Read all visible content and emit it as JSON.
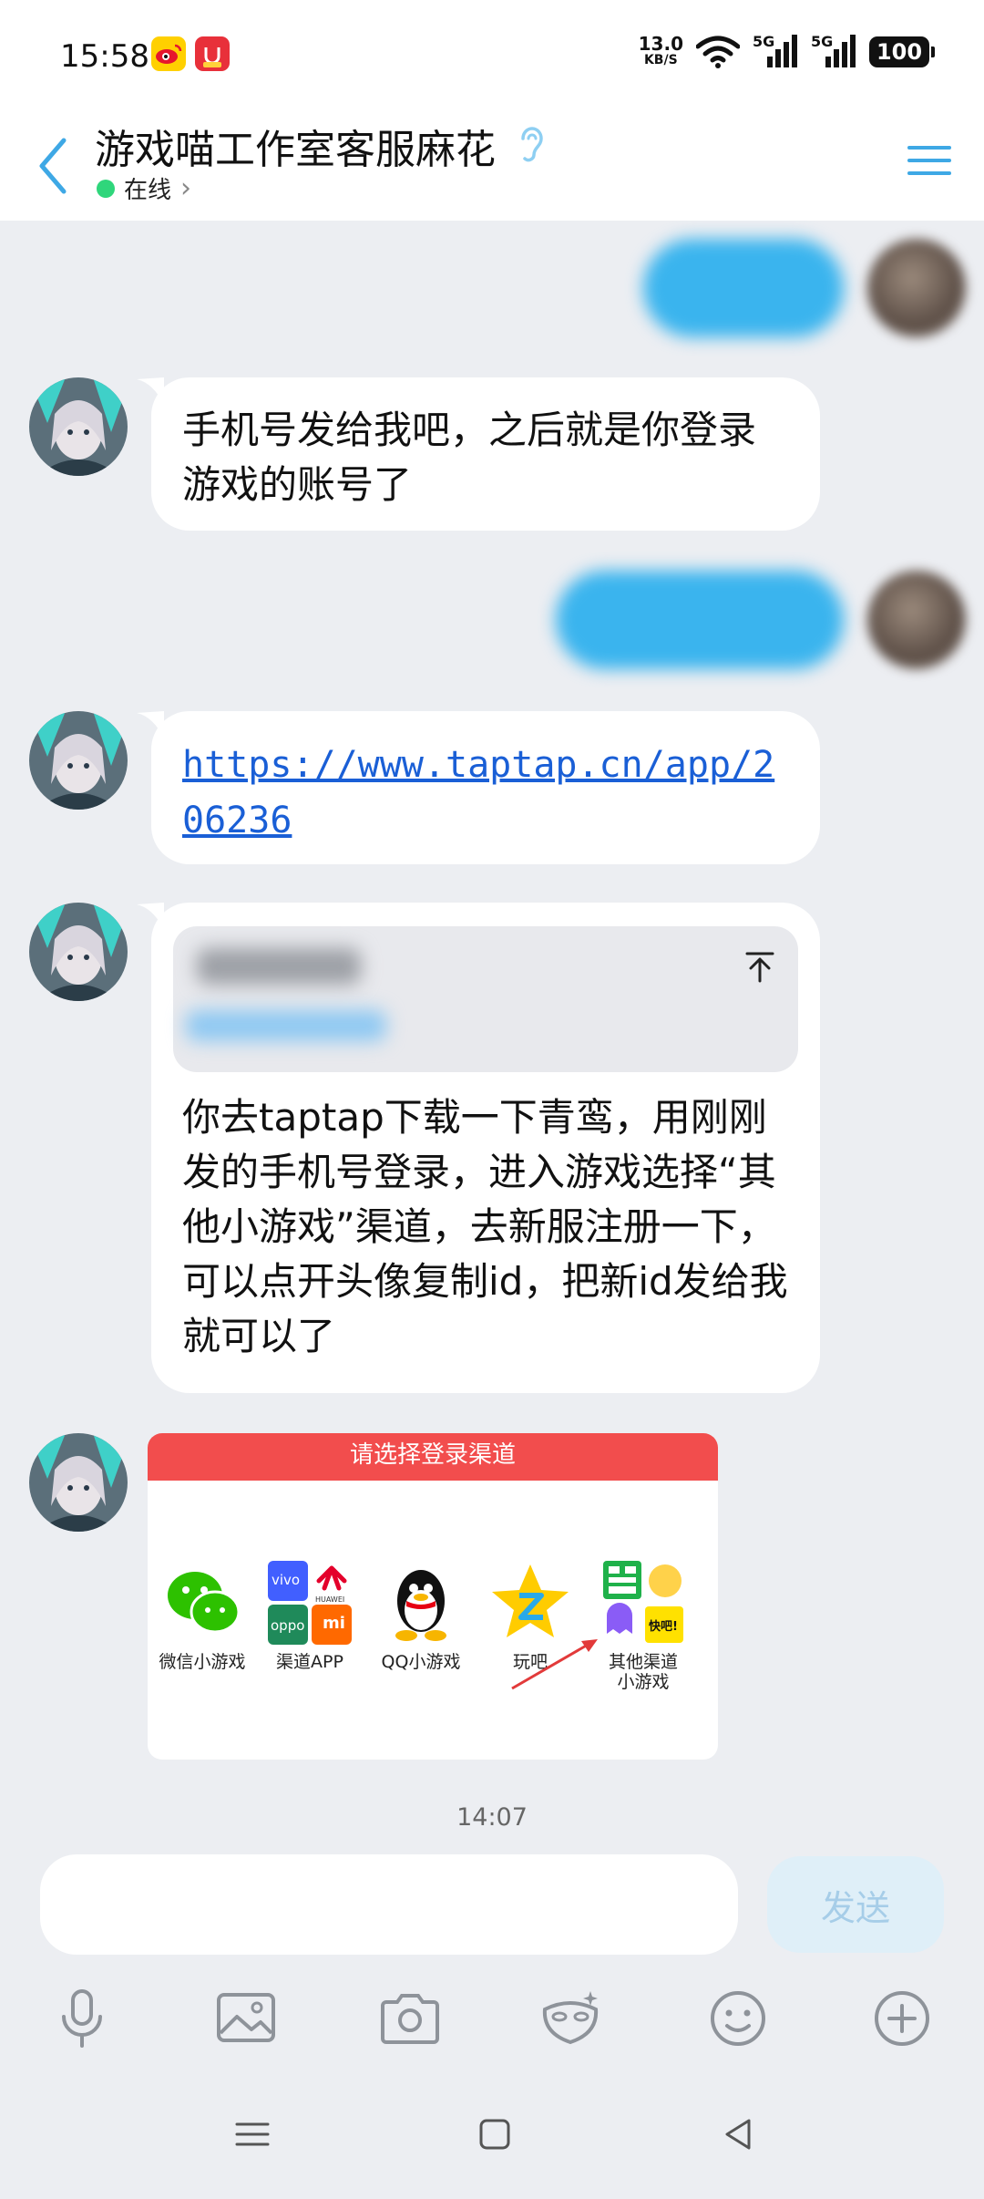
{
  "status_bar": {
    "time": "15:58",
    "net_speed_value": "13.0",
    "net_speed_unit": "KB/S",
    "network_1": "5G",
    "network_2": "5G",
    "battery": "100"
  },
  "header": {
    "title": "游戏喵工作室客服麻花",
    "status": "在线",
    "status_arrow": "›"
  },
  "messages": {
    "m1_text": "手机号发给我吧，之后就是你登录游戏的账号了",
    "m2_link": "https://www.taptap.cn/app/206236",
    "m3_text": "你去taptap下载一下青鸾，用刚刚发的手机号登录，进入游戏选择“其他小游戏”渠道，去新服注册一下，可以点开头像复制id，把新id发给我就可以了"
  },
  "image_card": {
    "header": "请选择登录渠道",
    "channels": [
      {
        "label": "微信小游戏",
        "icon": "wechat-icon"
      },
      {
        "label": "渠道APP",
        "icon": "vendor-apps-icon"
      },
      {
        "label": "QQ小游戏",
        "icon": "qq-icon"
      },
      {
        "label": "玩吧",
        "icon": "wanba-icon"
      },
      {
        "label": "其他渠道",
        "label2": "小游戏",
        "icon": "other-channels-icon"
      }
    ],
    "vendor_labels": [
      "vivo",
      "HUAWEI",
      "oppo",
      "mi"
    ],
    "kuaishou_badge": "快吧!"
  },
  "timestamp": "14:07",
  "input": {
    "placeholder": "",
    "send_label": "发送"
  },
  "colors": {
    "accent": "#3ea8e5",
    "online": "#2fd67b",
    "bubble": "#ffffff",
    "background": "#eceef2",
    "card_header": "#f24d4d"
  }
}
